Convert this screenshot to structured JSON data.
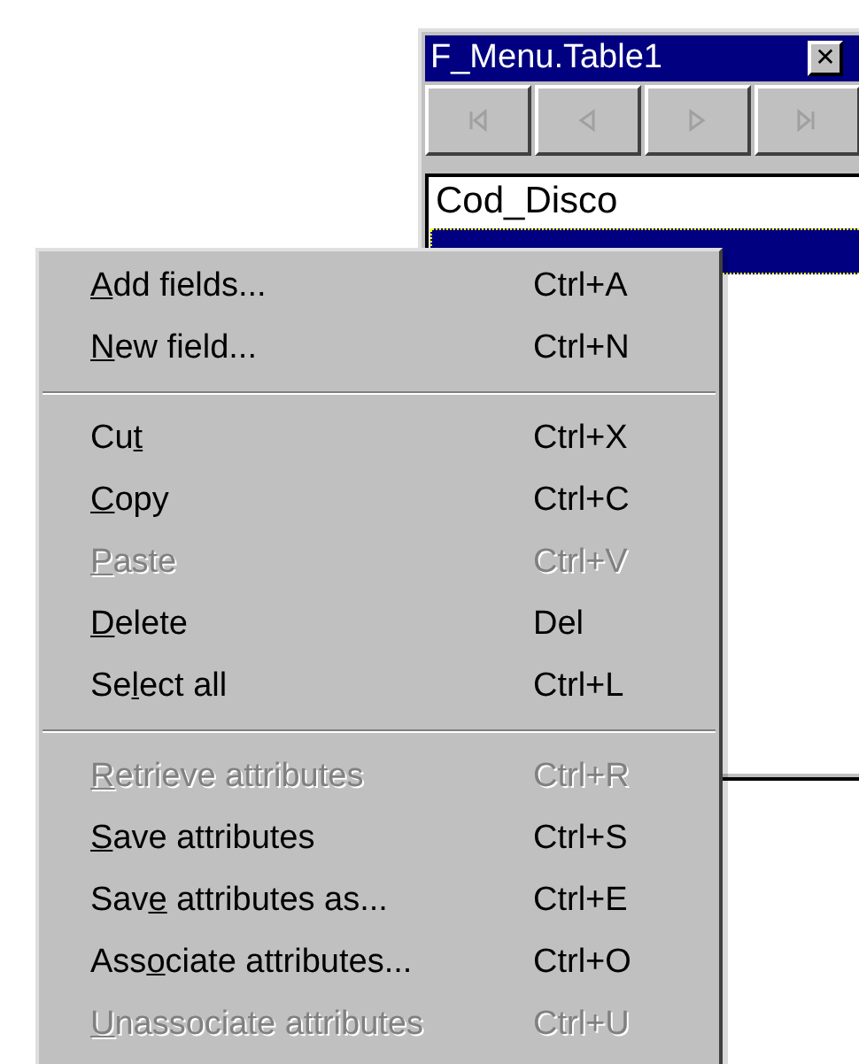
{
  "window": {
    "title": "F_Menu.Table1",
    "close": "✕",
    "nav_buttons": [
      {
        "kind": "first",
        "disabled": true
      },
      {
        "kind": "prev",
        "disabled": true
      },
      {
        "kind": "next",
        "disabled": true
      },
      {
        "kind": "last",
        "disabled": true
      }
    ],
    "list": [
      {
        "text": "Cod_Disco",
        "selected": false
      },
      {
        "selected": true
      }
    ]
  },
  "menu": {
    "groups": [
      [
        {
          "label": [
            {
              "text": "A",
              "underline": true
            },
            {
              "text": "dd fields..."
            }
          ],
          "shortcut": "Ctrl+A",
          "disabled": false
        },
        {
          "label": [
            {
              "text": "N",
              "underline": true
            },
            {
              "text": "ew field..."
            }
          ],
          "shortcut": "Ctrl+N",
          "disabled": false
        }
      ],
      [
        {
          "label": [
            {
              "text": "Cu"
            },
            {
              "text": "t",
              "underline": true
            }
          ],
          "shortcut": "Ctrl+X",
          "disabled": false
        },
        {
          "label": [
            {
              "text": "C",
              "underline": true
            },
            {
              "text": "opy"
            }
          ],
          "shortcut": "Ctrl+C",
          "disabled": false
        },
        {
          "label": [
            {
              "text": "P",
              "underline": true
            },
            {
              "text": "aste"
            }
          ],
          "shortcut": "Ctrl+V",
          "disabled": true
        },
        {
          "label": [
            {
              "text": "D",
              "underline": true
            },
            {
              "text": "elete"
            }
          ],
          "shortcut": "Del",
          "disabled": false
        },
        {
          "label": [
            {
              "text": "Se"
            },
            {
              "text": "l",
              "underline": true
            },
            {
              "text": "ect all"
            }
          ],
          "shortcut": "Ctrl+L",
          "disabled": false
        }
      ],
      [
        {
          "label": [
            {
              "text": "R",
              "underline": true
            },
            {
              "text": "etrieve attributes"
            }
          ],
          "shortcut": "Ctrl+R",
          "disabled": true
        },
        {
          "label": [
            {
              "text": "S",
              "underline": true
            },
            {
              "text": "ave attributes"
            }
          ],
          "shortcut": "Ctrl+S",
          "disabled": false
        },
        {
          "label": [
            {
              "text": "Sav"
            },
            {
              "text": "e",
              "underline": true
            },
            {
              "text": " attributes as..."
            }
          ],
          "shortcut": "Ctrl+E",
          "disabled": false
        },
        {
          "label": [
            {
              "text": "Ass"
            },
            {
              "text": "o",
              "underline": true
            },
            {
              "text": "ciate attributes..."
            }
          ],
          "shortcut": "Ctrl+O",
          "disabled": false
        },
        {
          "label": [
            {
              "text": "U",
              "underline": true
            },
            {
              "text": "nassociate attributes"
            }
          ],
          "shortcut": "Ctrl+U",
          "disabled": true
        }
      ]
    ]
  }
}
